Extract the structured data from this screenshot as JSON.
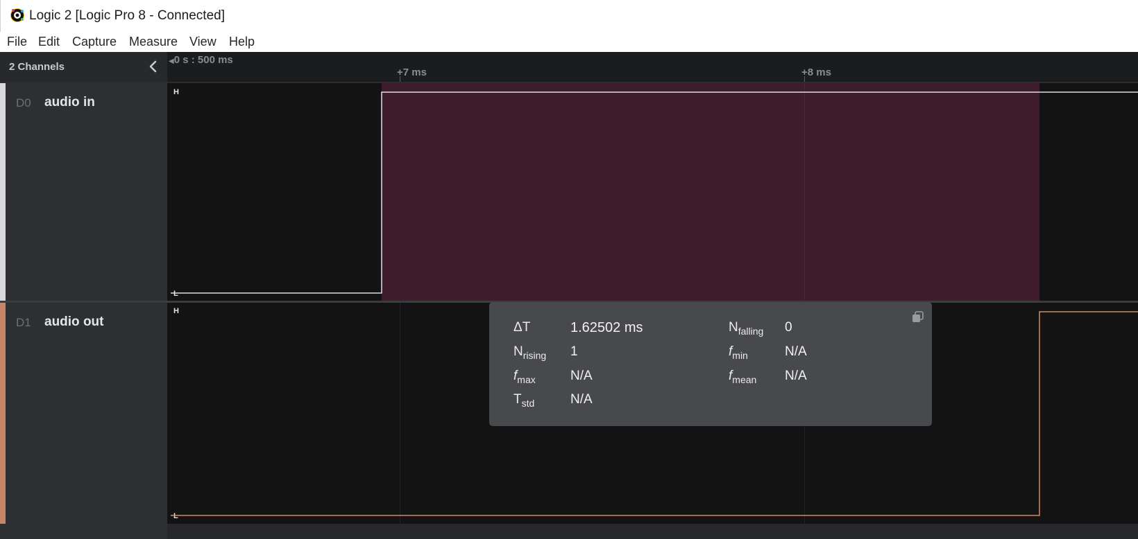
{
  "window": {
    "title": "Logic 2 [Logic Pro 8 - Connected]"
  },
  "menu": [
    {
      "label": "File"
    },
    {
      "label": "Edit"
    },
    {
      "label": "Capture"
    },
    {
      "label": "Measure"
    },
    {
      "label": "View"
    },
    {
      "label": "Help"
    }
  ],
  "channels_panel": {
    "title": "2 Channels"
  },
  "channels": [
    {
      "index": "D0",
      "name": "audio in",
      "color": "#e0e0e0",
      "high_label": "H",
      "low_label": "L"
    },
    {
      "index": "D1",
      "name": "audio out",
      "color": "#d4896b",
      "high_label": "H",
      "low_label": "L"
    }
  ],
  "timeline": {
    "origin": "0 s : 500 ms",
    "ticks": [
      "+7 ms",
      "+8 ms"
    ]
  },
  "measurement": {
    "delta_t": {
      "label": "ΔT",
      "value": "1.62502 ms"
    },
    "n_falling": {
      "label": "N",
      "sub": "falling",
      "value": "0"
    },
    "n_rising": {
      "label": "N",
      "sub": "rising",
      "value": "1"
    },
    "f_min": {
      "label": "f",
      "sub": "min",
      "value": "N/A"
    },
    "f_max": {
      "label": "f",
      "sub": "max",
      "value": "N/A"
    },
    "f_mean": {
      "label": "f",
      "sub": "mean",
      "value": "N/A"
    },
    "t_std": {
      "label": "T",
      "sub": "std",
      "value": "N/A"
    }
  },
  "colors": {
    "selection": "#3e1c2c",
    "channel0": "#e0e0e0",
    "channel1": "#d4896b"
  }
}
